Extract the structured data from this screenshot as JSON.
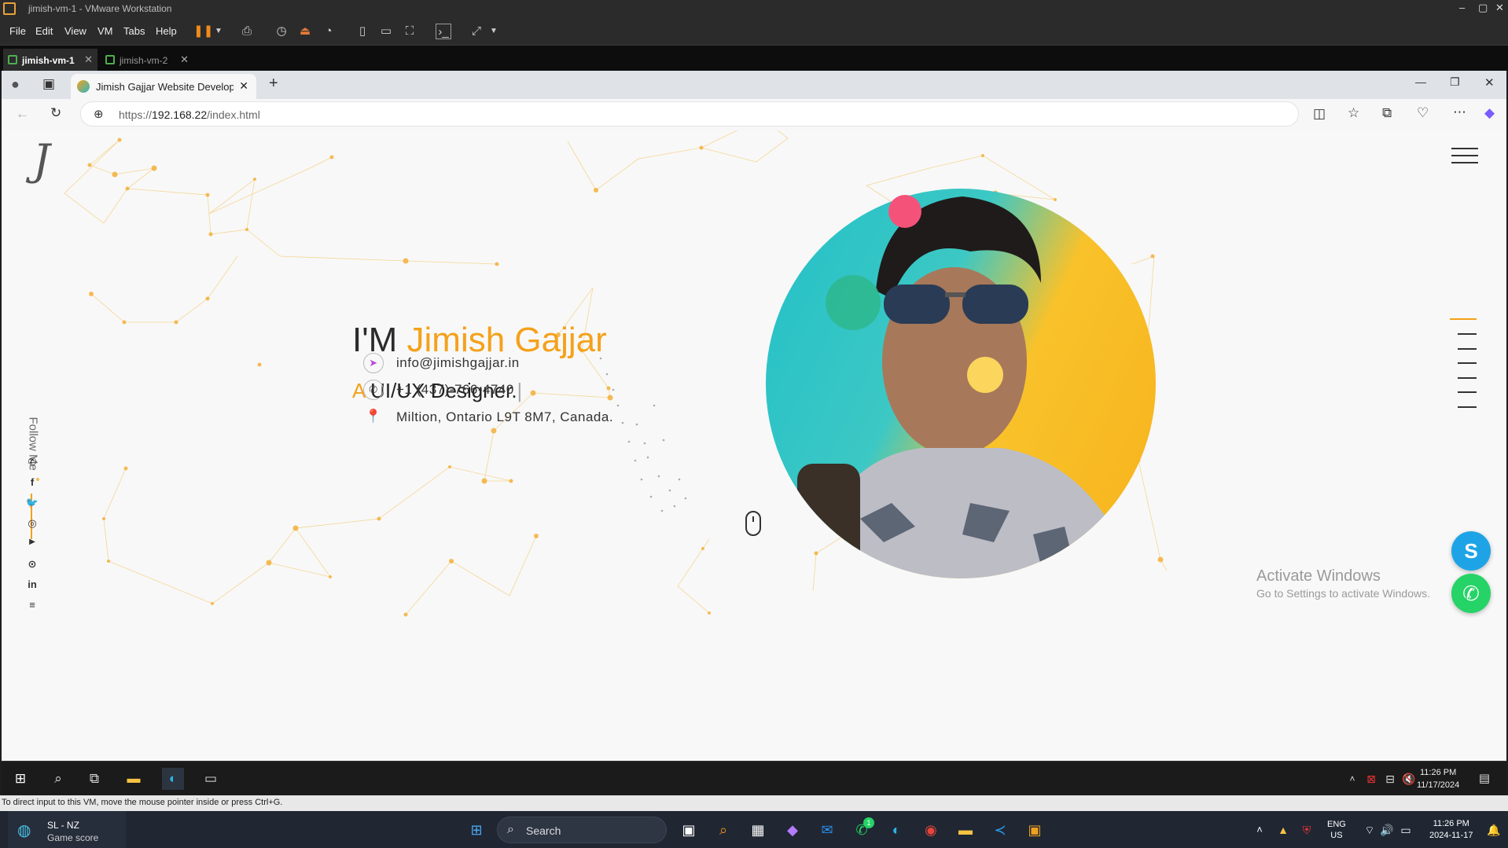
{
  "vmware": {
    "title": "jimish-vm-1 - VMware Workstation",
    "menu": [
      "File",
      "Edit",
      "View",
      "VM",
      "Tabs",
      "Help"
    ],
    "tabs": [
      {
        "label": "jimish-vm-1",
        "active": true
      },
      {
        "label": "jimish-vm-2",
        "active": false
      }
    ],
    "status_message": "To direct input to this VM, move the mouse pointer inside or press Ctrl+G."
  },
  "browser": {
    "tab_title": "Jimish Gajjar Website Developer &",
    "url_protocol": "https://",
    "url_host": "192.168.22",
    "url_path": "/index.html"
  },
  "page": {
    "logo": "J",
    "intro_prefix": "I'M ",
    "name": "Jimish Gajjar",
    "role_prefix": "A ",
    "role": "UI/UX Designer.",
    "contacts": [
      {
        "icon": "send-icon",
        "text": "info@jimishgajjar.in"
      },
      {
        "icon": "phone-icon",
        "text": "+1 (437)-766-4740"
      },
      {
        "icon": "location-pin-icon",
        "text": "Miltion, Ontario L9T 8M7, Canada."
      }
    ],
    "follow_label": "Follow Me",
    "social": [
      "whatsapp",
      "facebook",
      "twitter",
      "instagram",
      "youtube",
      "github",
      "linkedin",
      "stackoverflow"
    ],
    "accent_color": "#f4a11a"
  },
  "windows_notice": {
    "title": "Activate Windows",
    "subtitle": "Go to Settings to activate Windows."
  },
  "guest_taskbar": {
    "time": "11:26 PM",
    "date": "11/17/2024"
  },
  "host_taskbar": {
    "widget_title": "SL - NZ",
    "widget_subtitle": "Game score",
    "search_label": "Search",
    "lang": "ENG",
    "region": "US",
    "time": "11:26 PM",
    "date": "2024-11-17",
    "whatsapp_badge": "1"
  }
}
